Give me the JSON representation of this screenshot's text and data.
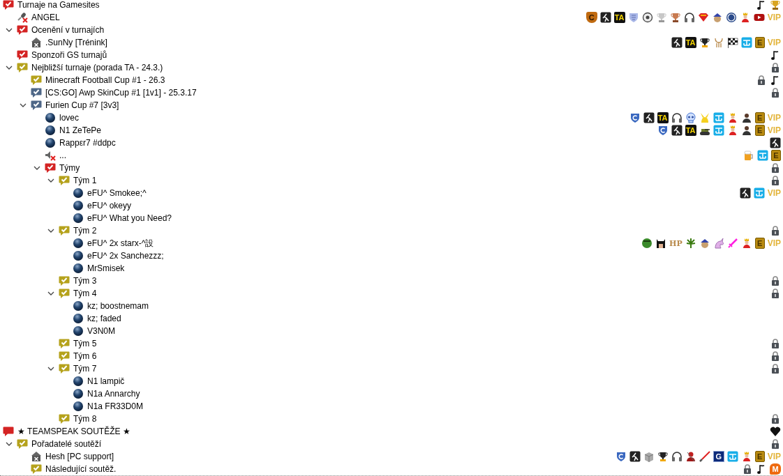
{
  "tree": [
    {
      "kind": "channel",
      "name": "Turnaje na Gamesites",
      "color": "#d42323",
      "checked": true,
      "badges": [
        {
          "kind": "note"
        },
        {
          "kind": "trophy"
        }
      ],
      "children": [
        {
          "kind": "client-mic-off",
          "name": "ANGEL",
          "badges": [
            {
              "kind": "c-shield",
              "text": "C"
            },
            {
              "kind": "runner"
            },
            {
              "kind": "ta",
              "text": "TA"
            },
            {
              "kind": "shield"
            },
            {
              "kind": "disc"
            },
            {
              "kind": "cup-silver"
            },
            {
              "kind": "cup-bronze"
            },
            {
              "kind": "headphones"
            },
            {
              "kind": "emblem"
            },
            {
              "kind": "cap-face"
            },
            {
              "kind": "roundel"
            },
            {
              "kind": "king"
            },
            {
              "kind": "play"
            },
            {
              "kind": "vip",
              "text": "VIP"
            }
          ]
        },
        {
          "kind": "channel",
          "name": "Ocenění v turnajích",
          "color": "#d42323",
          "checked": true,
          "expanded": true,
          "children": [
            {
              "kind": "client-away",
              "name": ".SunNy [Trénink]",
              "badges": [
                {
                  "kind": "runner"
                },
                {
                  "kind": "ta",
                  "text": "TA"
                },
                {
                  "kind": "trophy-dark"
                },
                {
                  "kind": "antlers"
                },
                {
                  "kind": "flag"
                },
                {
                  "kind": "beach"
                },
                {
                  "kind": "e",
                  "text": "E"
                },
                {
                  "kind": "vip",
                  "text": "VIP"
                }
              ]
            }
          ]
        },
        {
          "kind": "channel",
          "name": "Sponzoři GS turnajů",
          "color": "#d42323",
          "checked": true,
          "badges": [
            {
              "kind": "note"
            }
          ]
        },
        {
          "kind": "channel",
          "name": "Nejbližší turnaje (porada TA - 24.3.)",
          "color": "#b5a21c",
          "checked": true,
          "expanded": true,
          "badges": [
            {
              "kind": "lock"
            }
          ],
          "children": [
            {
              "kind": "channel",
              "name": "Minecraft Football Cup #1 - 26.3",
              "color": "#b5a21c",
              "checked": true,
              "badges": [
                {
                  "kind": "lock"
                },
                {
                  "kind": "note"
                }
              ]
            },
            {
              "kind": "channel",
              "name": "[CS:GO] Awp SkinCup #1 [1v1] - 25.3.17",
              "color": "#4e6787",
              "checked": true,
              "badges": [
                {
                  "kind": "lock"
                }
              ]
            },
            {
              "kind": "channel",
              "name": "Furien Cup #7 [3v3]",
              "color": "#4e6787",
              "checked": true,
              "expanded": true,
              "children": [
                {
                  "kind": "client",
                  "name": "lovec",
                  "badges": [
                    {
                      "kind": "shield-blue"
                    },
                    {
                      "kind": "runner"
                    },
                    {
                      "kind": "ta",
                      "text": "TA"
                    },
                    {
                      "kind": "headphones"
                    },
                    {
                      "kind": "skull"
                    },
                    {
                      "kind": "creature"
                    },
                    {
                      "kind": "beach"
                    },
                    {
                      "kind": "king"
                    },
                    {
                      "kind": "person"
                    },
                    {
                      "kind": "e",
                      "text": "E"
                    },
                    {
                      "kind": "vip",
                      "text": "VIP"
                    }
                  ]
                },
                {
                  "kind": "client",
                  "name": "N1 ZeTePe",
                  "badges": [
                    {
                      "kind": "shield-blue"
                    },
                    {
                      "kind": "runner"
                    },
                    {
                      "kind": "ta",
                      "text": "TA"
                    },
                    {
                      "kind": "tank"
                    },
                    {
                      "kind": "beach"
                    },
                    {
                      "kind": "king"
                    },
                    {
                      "kind": "person"
                    },
                    {
                      "kind": "e",
                      "text": "E"
                    },
                    {
                      "kind": "vip",
                      "text": "VIP"
                    }
                  ]
                },
                {
                  "kind": "client",
                  "name": "Rappεr7 #ddpc",
                  "badges": [
                    {
                      "kind": "runner"
                    }
                  ]
                },
                {
                  "kind": "client-muted",
                  "name": "...",
                  "badges": [
                    {
                      "kind": "mug"
                    },
                    {
                      "kind": "beach"
                    },
                    {
                      "kind": "e",
                      "text": "E"
                    }
                  ]
                },
                {
                  "kind": "channel",
                  "name": "Týmy",
                  "color": "#d42323",
                  "checked": true,
                  "expanded": true,
                  "badges": [
                    {
                      "kind": "lock"
                    }
                  ],
                  "children": [
                    {
                      "kind": "channel",
                      "name": "Tým 1",
                      "color": "#b5a21c",
                      "checked": true,
                      "expanded": true,
                      "badges": [
                        {
                          "kind": "lock"
                        }
                      ],
                      "children": [
                        {
                          "kind": "client",
                          "name": "eFU^ Smokee;^",
                          "badges": [
                            {
                              "kind": "runner"
                            },
                            {
                              "kind": "beach"
                            },
                            {
                              "kind": "vip",
                              "text": "VIP"
                            }
                          ]
                        },
                        {
                          "kind": "client",
                          "name": "eFU^ okeyy"
                        },
                        {
                          "kind": "client",
                          "name": "eFU^ What you Need?"
                        }
                      ]
                    },
                    {
                      "kind": "channel",
                      "name": "Tým 2",
                      "color": "#b5a21c",
                      "checked": true,
                      "expanded": true,
                      "badges": [
                        {
                          "kind": "lock"
                        }
                      ],
                      "children": [
                        {
                          "kind": "client",
                          "name": "eFU^ 2x starx-^設",
                          "badges": [
                            {
                              "kind": "monster"
                            },
                            {
                              "kind": "masked"
                            },
                            {
                              "kind": "hp",
                              "text": "HP"
                            },
                            {
                              "kind": "leaf"
                            },
                            {
                              "kind": "cap-face"
                            },
                            {
                              "kind": "unicorn"
                            },
                            {
                              "kind": "sword"
                            },
                            {
                              "kind": "king"
                            },
                            {
                              "kind": "e",
                              "text": "E"
                            },
                            {
                              "kind": "vip",
                              "text": "VIP"
                            }
                          ]
                        },
                        {
                          "kind": "client",
                          "name": "eFU^ 2x Sanchezzz;"
                        },
                        {
                          "kind": "client",
                          "name": "MrSmisek"
                        }
                      ]
                    },
                    {
                      "kind": "channel",
                      "name": "Tým 3",
                      "color": "#b5a21c",
                      "checked": true,
                      "badges": [
                        {
                          "kind": "lock"
                        }
                      ]
                    },
                    {
                      "kind": "channel",
                      "name": "Tým 4",
                      "color": "#b5a21c",
                      "checked": true,
                      "expanded": true,
                      "badges": [
                        {
                          "kind": "lock"
                        }
                      ],
                      "children": [
                        {
                          "kind": "client",
                          "name": "kz; boostnemam"
                        },
                        {
                          "kind": "client",
                          "name": "kz; faded"
                        },
                        {
                          "kind": "client",
                          "name": "V3N0M"
                        }
                      ]
                    },
                    {
                      "kind": "channel",
                      "name": "Tým 5",
                      "color": "#b5a21c",
                      "checked": true,
                      "badges": [
                        {
                          "kind": "lock"
                        }
                      ]
                    },
                    {
                      "kind": "channel",
                      "name": "Tým 6",
                      "color": "#b5a21c",
                      "checked": true,
                      "badges": [
                        {
                          "kind": "lock"
                        }
                      ]
                    },
                    {
                      "kind": "channel",
                      "name": "Tým 7",
                      "color": "#b5a21c",
                      "checked": true,
                      "expanded": true,
                      "badges": [
                        {
                          "kind": "lock"
                        }
                      ],
                      "children": [
                        {
                          "kind": "client",
                          "name": "N1 lampič"
                        },
                        {
                          "kind": "client",
                          "name": "N1a Annarchy"
                        },
                        {
                          "kind": "client",
                          "name": "N1a FR33D0M"
                        }
                      ]
                    },
                    {
                      "kind": "channel",
                      "name": "Tým 8",
                      "color": "#b5a21c",
                      "checked": true,
                      "badges": [
                        {
                          "kind": "lock"
                        }
                      ]
                    }
                  ]
                }
              ]
            }
          ]
        }
      ]
    },
    {
      "kind": "channel",
      "name": "★ TEAMSPEAK SOUTĚŽE ★",
      "color": "#d42323",
      "checked": false,
      "badges": [
        {
          "kind": "heart"
        }
      ],
      "children": [
        {
          "kind": "channel",
          "name": "Pořadatelé soutěží",
          "color": "#b5a21c",
          "checked": true,
          "expanded": true,
          "badges": [
            {
              "kind": "lock"
            }
          ],
          "children": [
            {
              "kind": "client-away",
              "name": "Hesh [PC support]",
              "badges": [
                {
                  "kind": "shield-blue"
                },
                {
                  "kind": "runner"
                },
                {
                  "kind": "box"
                },
                {
                  "kind": "trophy-dark"
                },
                {
                  "kind": "headphones"
                },
                {
                  "kind": "red-figure"
                },
                {
                  "kind": "saber"
                },
                {
                  "kind": "g",
                  "text": "G"
                },
                {
                  "kind": "beach"
                },
                {
                  "kind": "king"
                },
                {
                  "kind": "e",
                  "text": "E"
                },
                {
                  "kind": "vip",
                  "text": "VIP"
                }
              ]
            },
            {
              "kind": "channel",
              "name": "Následující soutěž.",
              "color": "#b5a21c",
              "checked": true,
              "badges": [
                {
                  "kind": "lock"
                },
                {
                  "kind": "note"
                },
                {
                  "kind": "m",
                  "text": "M"
                }
              ]
            }
          ]
        }
      ]
    }
  ]
}
